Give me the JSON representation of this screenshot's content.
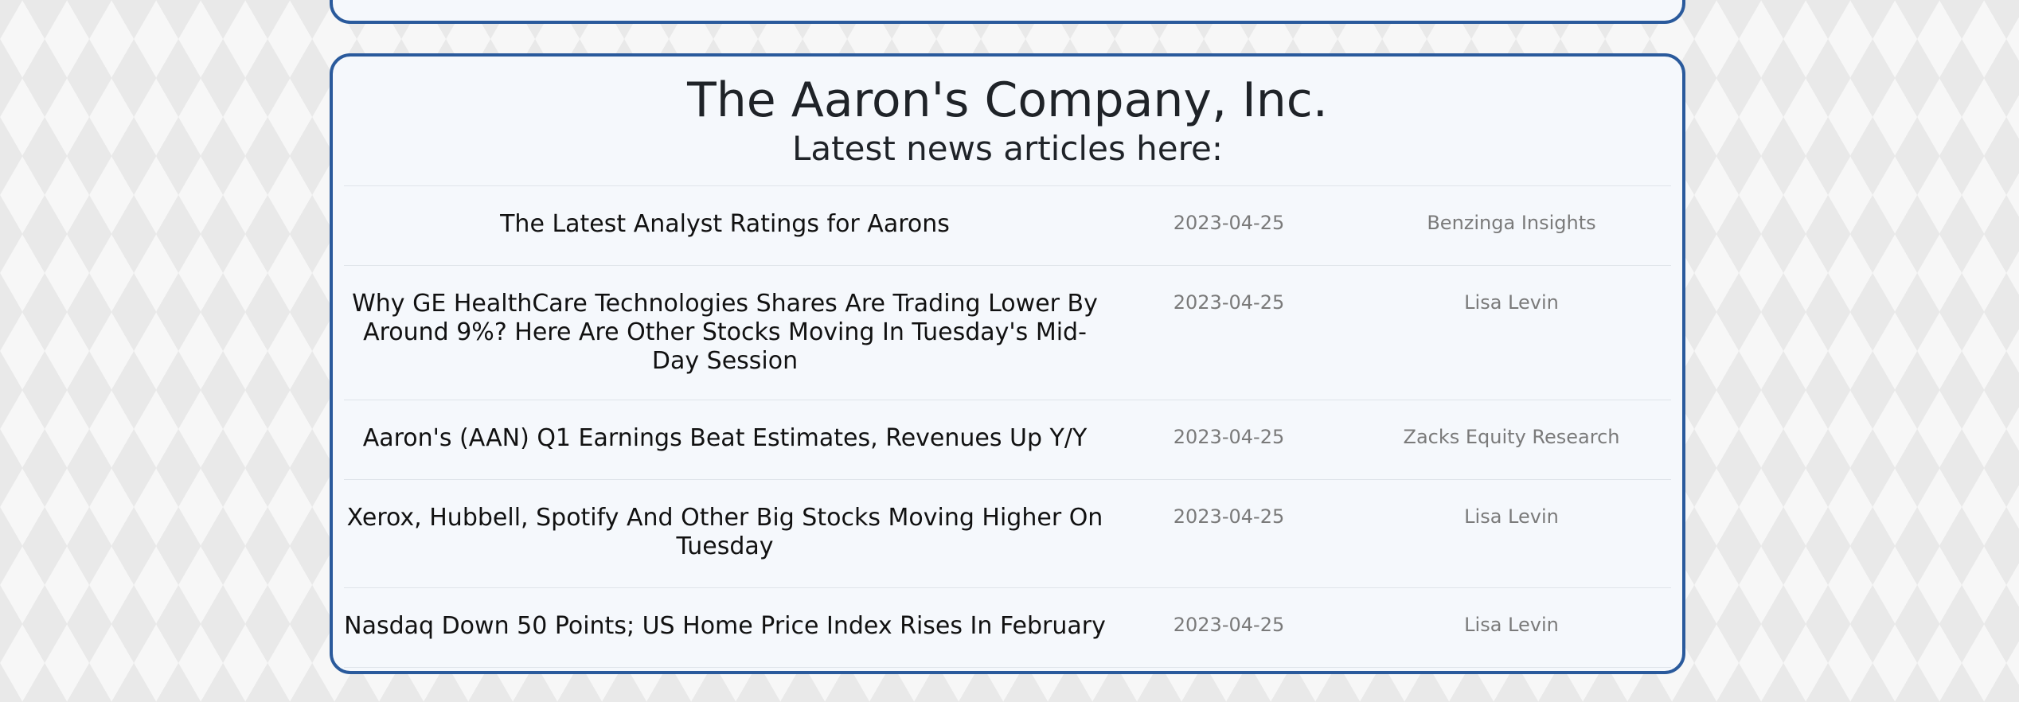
{
  "company": {
    "name": "The Aaron's Company, Inc.",
    "subtitle": "Latest news articles here:"
  },
  "articles": [
    {
      "headline": "The Latest Analyst Ratings for Aarons",
      "date": "2023-04-25",
      "author": "Benzinga Insights"
    },
    {
      "headline": "Why GE HealthCare Technologies Shares Are Trading Lower By Around 9%? Here Are Other Stocks Moving In Tuesday's Mid-Day Session",
      "date": "2023-04-25",
      "author": "Lisa Levin"
    },
    {
      "headline": "Aaron's (AAN) Q1 Earnings Beat Estimates, Revenues Up Y/Y",
      "date": "2023-04-25",
      "author": "Zacks Equity Research"
    },
    {
      "headline": "Xerox, Hubbell, Spotify And Other Big Stocks Moving Higher On Tuesday",
      "date": "2023-04-25",
      "author": "Lisa Levin"
    },
    {
      "headline": "Nasdaq Down 50 Points; US Home Price Index Rises In February",
      "date": "2023-04-25",
      "author": "Lisa Levin"
    }
  ],
  "colors": {
    "panel_border": "#2a5a9c",
    "panel_background": "#f5f8fc",
    "headline_text": "#111111",
    "meta_text": "#7a7a7a"
  }
}
